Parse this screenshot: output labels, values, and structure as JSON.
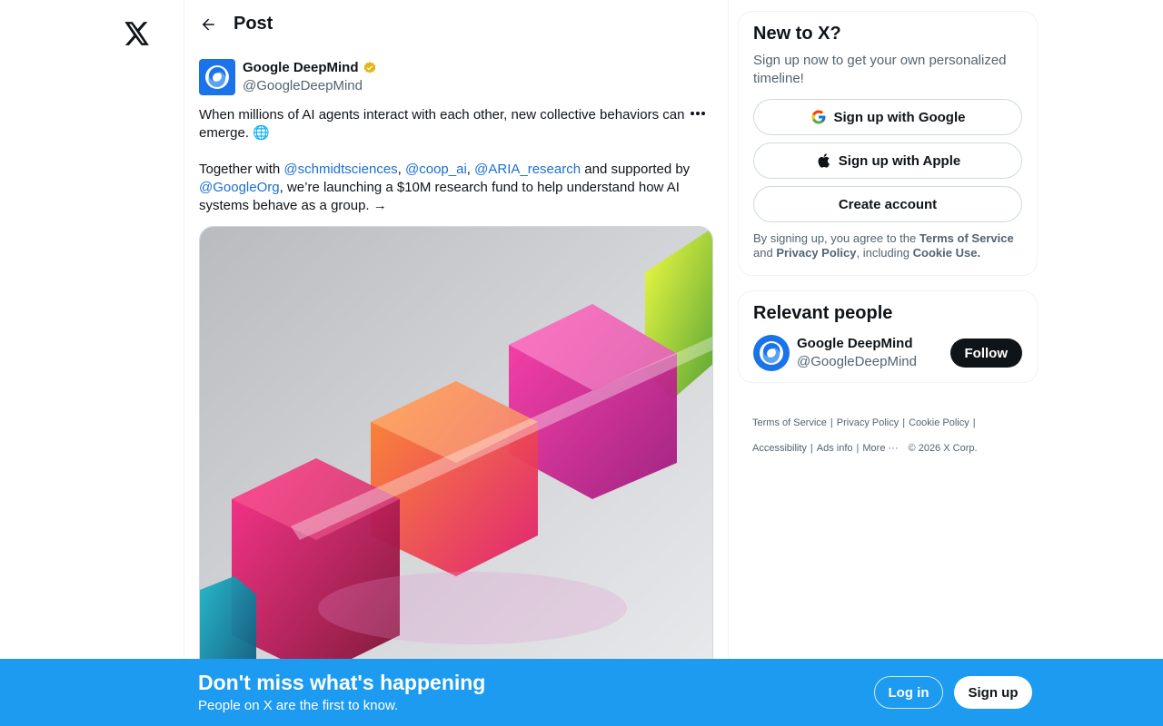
{
  "main": {
    "title": "Post"
  },
  "tweet": {
    "author_name": "Google DeepMind",
    "author_handle": "@GoogleDeepMind",
    "line1": "When millions of AI agents interact with each other, new collective behaviors can emerge. 🌐",
    "line2_prefix": "Together with ",
    "mention1": "@schmidtsciences",
    "sep1": ", ",
    "mention2": "@coop_ai",
    "sep2": ", ",
    "mention3": "@ARIA_research",
    "line2_mid": " and supported by ",
    "mention4": "@GoogleOrg",
    "line2_suffix": ", we’re launching a $10M research fund to help understand how AI systems behave as a group. →"
  },
  "sidebar": {
    "new_title": "New to X?",
    "new_sub": "Sign up now to get your own personalized timeline!",
    "google_btn": "Sign up with Google",
    "apple_btn": "Sign up with Apple",
    "create_btn": "Create account",
    "legal_prefix": "By signing up, you agree to the ",
    "legal_tos": "Terms of Service",
    "legal_and": " and ",
    "legal_privacy": "Privacy Policy",
    "legal_including": ", including ",
    "legal_cookie": "Cookie Use.",
    "relevant_title": "Relevant people",
    "person_name": "Google DeepMind",
    "person_handle": "@GoogleDeepMind",
    "follow_label": "Follow"
  },
  "footer": {
    "tos": "Terms of Service",
    "privacy": "Privacy Policy",
    "cookie": "Cookie Policy",
    "accessibility": "Accessibility",
    "ads": "Ads info",
    "more": "More ···",
    "copyright": "© 2026 X Corp.",
    "divider": "|"
  },
  "banner": {
    "title": "Don't miss what's happening",
    "subtitle": "People on X are the first to know.",
    "login": "Log in",
    "signup": "Sign up"
  },
  "colors": {
    "accent": "#1d9bf0",
    "link": "#1a6fd0",
    "text": "#0f1419",
    "muted": "#536471"
  }
}
